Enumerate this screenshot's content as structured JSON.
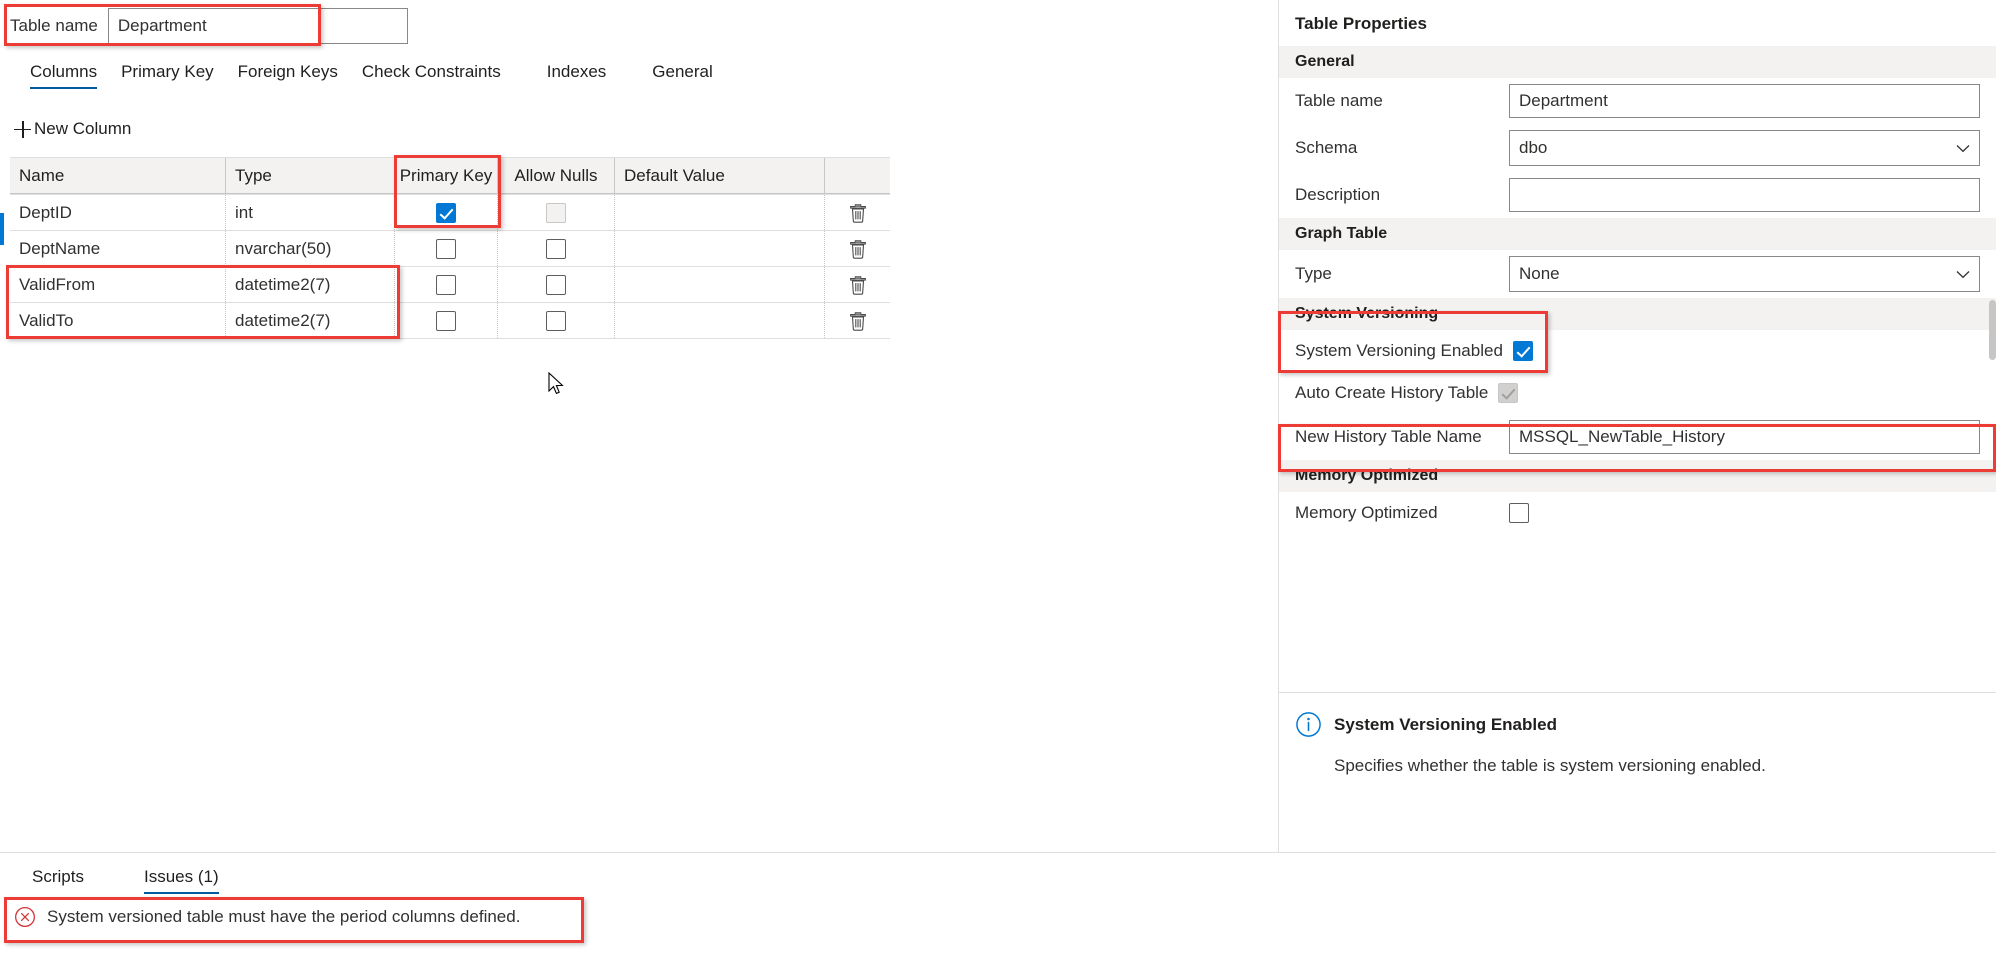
{
  "designer": {
    "table_name_label": "Table name",
    "table_name_value": "Department",
    "tabs": [
      {
        "label": "Columns",
        "active": true
      },
      {
        "label": "Primary Key",
        "active": false
      },
      {
        "label": "Foreign Keys",
        "active": false
      },
      {
        "label": "Check Constraints",
        "active": false
      },
      {
        "label": "Indexes",
        "active": false
      },
      {
        "label": "General",
        "active": false
      }
    ],
    "new_column_label": "New Column",
    "grid": {
      "headers": [
        "Name",
        "Type",
        "Primary Key",
        "Allow Nulls",
        "Default Value",
        ""
      ],
      "rows": [
        {
          "name": "DeptID",
          "type": "int",
          "primary_key": true,
          "pk_disabled": false,
          "allow_nulls": false,
          "nulls_disabled": true,
          "default_value": "",
          "delete_icon": "trash-icon"
        },
        {
          "name": "DeptName",
          "type": "nvarchar(50)",
          "primary_key": false,
          "pk_disabled": false,
          "allow_nulls": false,
          "nulls_disabled": false,
          "default_value": "",
          "delete_icon": "trash-icon"
        },
        {
          "name": "ValidFrom",
          "type": "datetime2(7)",
          "primary_key": false,
          "pk_disabled": false,
          "allow_nulls": false,
          "nulls_disabled": false,
          "default_value": "",
          "delete_icon": "trash-icon"
        },
        {
          "name": "ValidTo",
          "type": "datetime2(7)",
          "primary_key": false,
          "pk_disabled": false,
          "allow_nulls": false,
          "nulls_disabled": false,
          "default_value": "",
          "delete_icon": "trash-icon"
        }
      ]
    }
  },
  "properties": {
    "title": "Table Properties",
    "sections": {
      "general": {
        "heading": "General",
        "table_name_label": "Table name",
        "table_name_value": "Department",
        "schema_label": "Schema",
        "schema_value": "dbo",
        "description_label": "Description",
        "description_value": ""
      },
      "graph_table": {
        "heading": "Graph Table",
        "type_label": "Type",
        "type_value": "None"
      },
      "system_versioning": {
        "heading": "System Versioning",
        "enabled_label": "System Versioning Enabled",
        "enabled_checked": true,
        "auto_create_label": "Auto Create History Table",
        "auto_create_checked": true,
        "auto_create_disabled": true,
        "history_name_label": "New History Table Name",
        "history_name_value": "MSSQL_NewTable_History"
      },
      "memory_optimized": {
        "heading": "Memory Optimized",
        "label": "Memory Optimized",
        "checked": false
      }
    },
    "info": {
      "icon": "info-icon",
      "title": "System Versioning Enabled",
      "description": "Specifies whether the table is system versioning enabled."
    }
  },
  "bottom": {
    "tabs": [
      {
        "label": "Scripts",
        "active": false
      },
      {
        "label": "Issues (1)",
        "active": true
      }
    ],
    "issues": [
      {
        "icon": "error-icon",
        "text": "System versioned table must have the period columns defined."
      }
    ]
  },
  "colors": {
    "accent": "#0078d4",
    "tab_underline": "#005a9e",
    "annotation": "#ed3b36",
    "error": "#d13438",
    "section_bg": "#f3f2f1",
    "border": "#c8c6c4"
  }
}
